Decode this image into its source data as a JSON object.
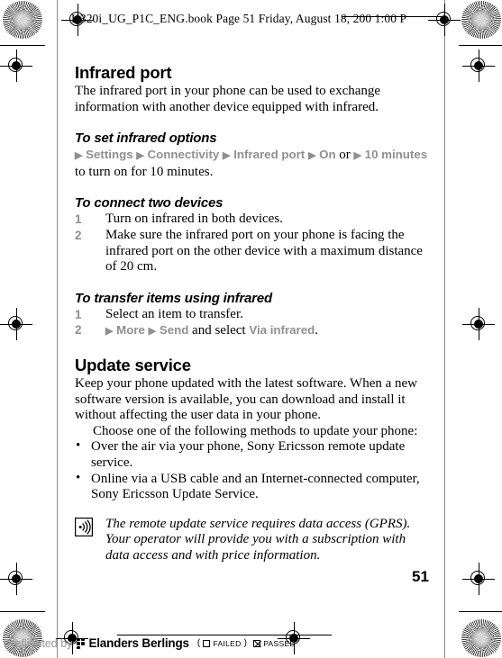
{
  "header": {
    "slug": "K320i_UG_P1C_ENG.book  Page 51  Friday, August 18, 200  1:00 P"
  },
  "page": {
    "number": "51"
  },
  "sections": [
    {
      "title": "Infrared port",
      "body": "The infrared port in your phone can be used to exchange information with another device equipped with infrared."
    }
  ],
  "infrared": {
    "heading": "Infrared port",
    "intro": "The infrared port in your phone can be used to exchange information with another device equipped with infrared.",
    "set_options": {
      "heading": "To set infrared options",
      "arrow": "▶",
      "path": [
        "Settings",
        "Connectivity",
        "Infrared port",
        "On"
      ],
      "or": "or",
      "path_alt": "10 minutes",
      "tail": "to turn on for 10 minutes."
    },
    "connect_devices": {
      "heading": "To connect two devices",
      "steps": [
        {
          "num": "1",
          "text": "Turn on infrared in both devices."
        },
        {
          "num": "2",
          "text": "Make sure the infrared port on your phone is facing the infrared port on the other device with a maximum distance of 20 cm."
        }
      ]
    },
    "transfer_items": {
      "heading": "To transfer items using infrared",
      "steps": [
        {
          "num": "1",
          "text": "Select an item to transfer."
        }
      ],
      "step2": {
        "num": "2",
        "arrow": "▶",
        "more": "More",
        "send": "Send",
        "mid": "and select",
        "via": "Via infrared",
        "period": "."
      }
    }
  },
  "update": {
    "heading": "Update service",
    "intro": "Keep your phone updated with the latest software. When a new software version is available, you can download and install it without affecting the user data in your phone.",
    "choose": "Choose one of the following methods to update your phone:",
    "bullet_char": "•",
    "methods": [
      "Over the air via your phone, Sony Ericsson remote update service.",
      "Online via a USB cable and an Internet-connected computer, Sony Ericsson Update Service."
    ],
    "note": "The remote update service requires data access (GPRS). Your operator will provide you with a subscription with data access and with price information."
  },
  "footer": {
    "preflighted_by": "Preflighted by",
    "brand": "Elanders Berlings",
    "paren_open": "(",
    "failed_label": "FAILED",
    "paren_close": ")",
    "passed_label": "PASSED"
  },
  "colors": {
    "nav_gray": "#8f8f8f",
    "text_black": "#000000",
    "trim_gray": "#8a8a8a"
  }
}
